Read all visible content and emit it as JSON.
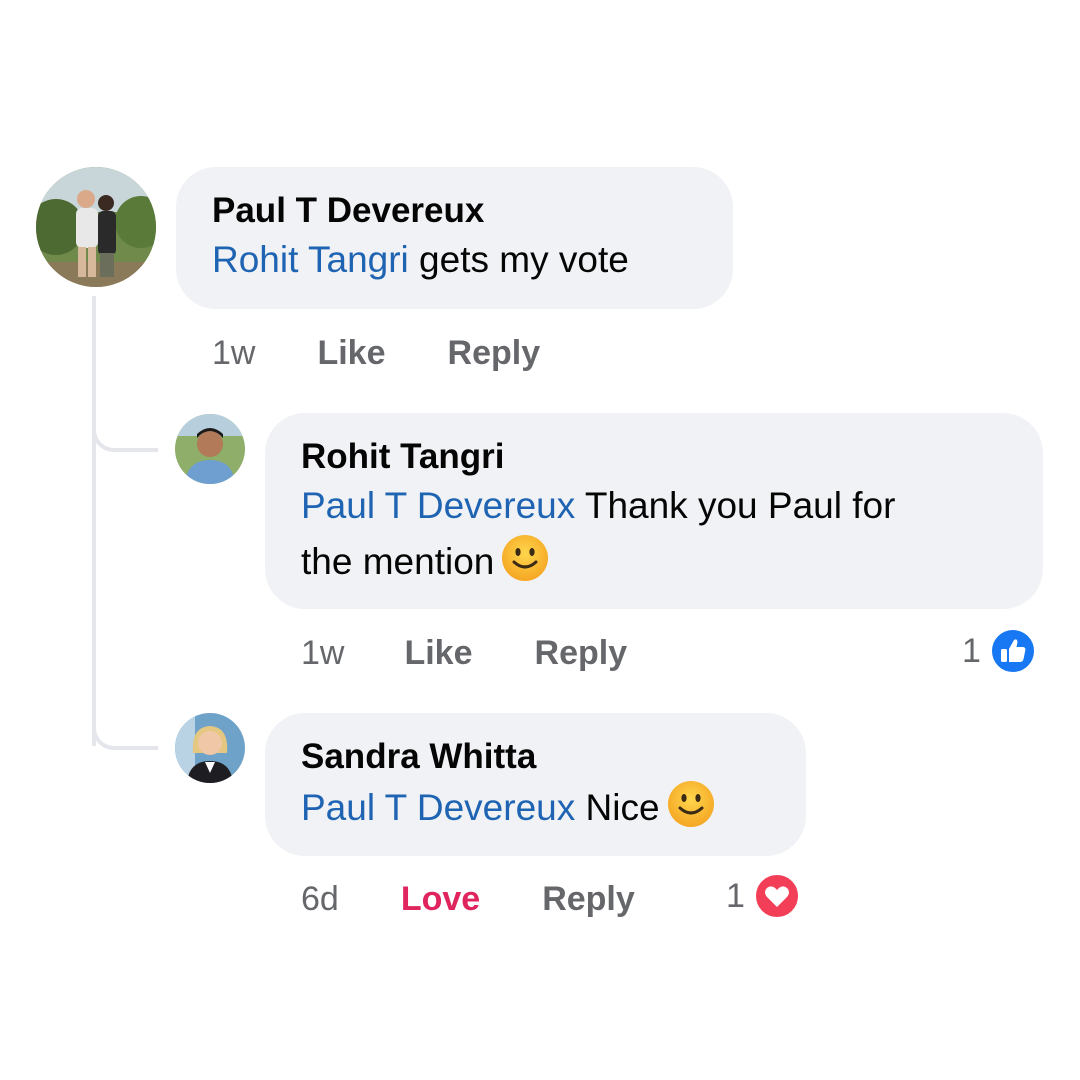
{
  "comments": [
    {
      "author": "Paul T Devereux",
      "mention": "Rohit Tangri",
      "text": " gets my vote",
      "age": "1w",
      "like_label": "Like",
      "reply_label": "Reply"
    },
    {
      "author": "Rohit Tangri",
      "mention": "Paul T Devereux",
      "text_line1": " Thank you Paul for",
      "text_line2": "the mention",
      "age": "1w",
      "like_label": "Like",
      "reply_label": "Reply",
      "reaction_count": "1",
      "reaction_icon": "like-icon"
    },
    {
      "author": "Sandra Whitta",
      "mention": "Paul T Devereux",
      "text": " Nice",
      "age": "6d",
      "love_label": "Love",
      "reply_label": "Reply",
      "reaction_count": "1",
      "reaction_icon": "love-icon"
    }
  ],
  "colors": {
    "mention": "#1f64b3",
    "bubble": "#f0f2f5",
    "meta": "#65676b",
    "love": "#e0245e",
    "like_blue": "#1877f2"
  }
}
